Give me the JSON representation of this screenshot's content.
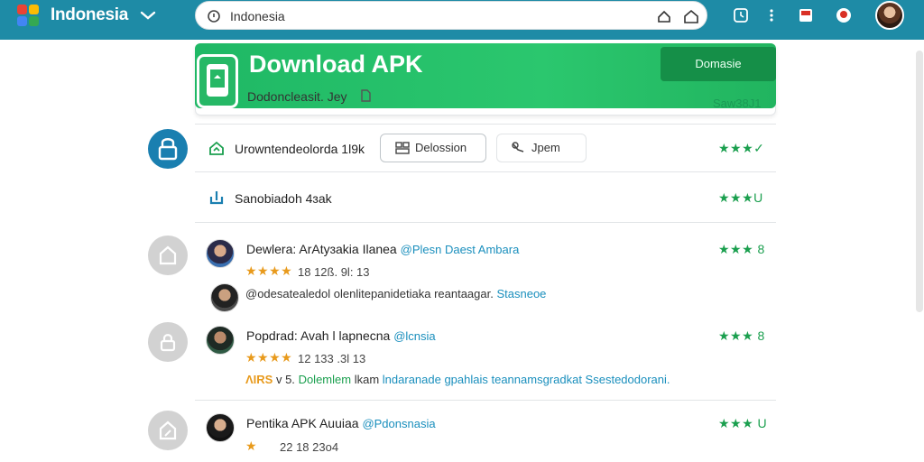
{
  "browser": {
    "brand": "Indonesia",
    "address": "Indonesia",
    "colors": {
      "topbar": "#1e8ba6",
      "accent_green": "#1fb865",
      "star_green": "#1a9f4e",
      "star_orange": "#e89a1c",
      "link_blue": "#1a8fbd"
    }
  },
  "download": {
    "title": "Download APK",
    "button": "Domasie",
    "subtitle": "Dodoncleasit. Jey",
    "size": "Saw38J1"
  },
  "install_row": {
    "label": "Urowntendeolorda 1l9k",
    "button_primary": "Delossion",
    "button_secondary": "Jpem",
    "stars": "★★★✓"
  },
  "update_row": {
    "label": "Sanobiadoh 4ɜak",
    "stars": "★★★U"
  },
  "reviews": [
    {
      "author": "Dewlera: ArAtyɜakia Ilanea",
      "handle": "@Plesn Daest Ambara",
      "stars": "★★★★",
      "meta": "18 12ß. 9l: 13",
      "side_stars": "★★★ 8",
      "reply_text": "@odesatealedol olenlitepanidetiaka reantaagar.",
      "reply_handle": "Stasneoe"
    },
    {
      "author": "Popdrad: Avah l lapnecna",
      "handle": "@lcnsia",
      "stars": "★★★★",
      "meta": "12 133 .3l 13",
      "side_stars": "★★★ 8",
      "tag": "ɅIRS",
      "tag_suffix": "v 5.",
      "body_green": "Dolemlem",
      "body_dark": "lkam",
      "body_blue": "lndaranade gpahlais teannamsgradkat Ssestedodorani."
    },
    {
      "author": "Pentika APK Auuiaa",
      "handle": "@Pdonsnasia",
      "stars": "★",
      "meta": "22 18 23o4",
      "side_stars": "★★★ U"
    }
  ]
}
